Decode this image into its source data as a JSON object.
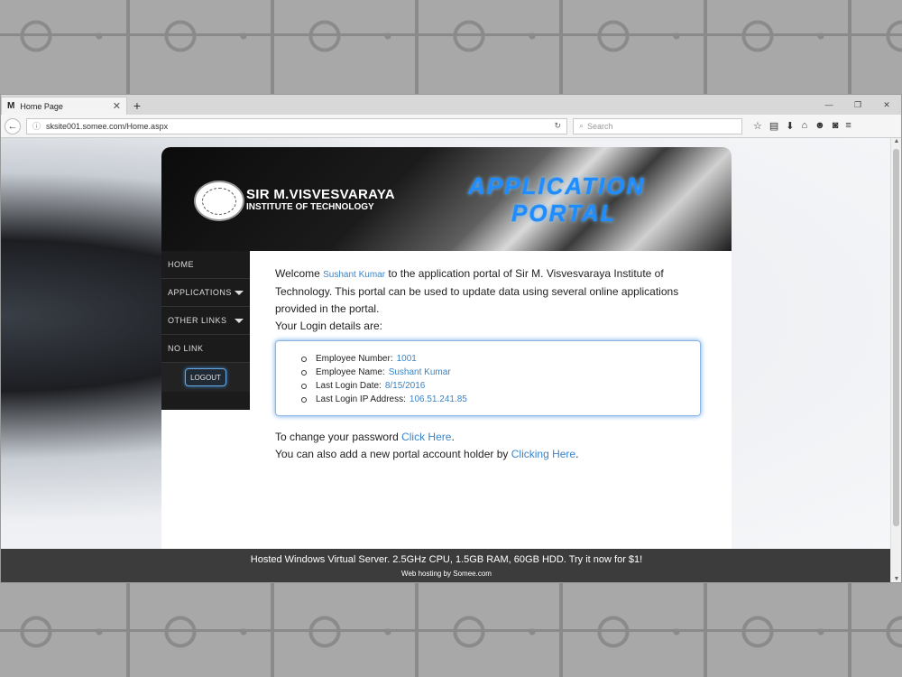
{
  "browser": {
    "tab_title": "Home Page",
    "tab_favicon": "M",
    "url": "sksite001.somee.com/Home.aspx",
    "search_placeholder": "Search"
  },
  "site": {
    "institution_line1": "SIR M.VISVESVARAYA",
    "institution_line2": "INSTITUTE OF TECHNOLOGY",
    "portal_title_line1": "APPLICATION",
    "portal_title_line2": "PORTAL",
    "accent_color": "#1f8cff"
  },
  "sidebar": {
    "items": [
      {
        "label": "HOME"
      },
      {
        "label": "APPLICATIONS"
      },
      {
        "label": "OTHER LINKS"
      },
      {
        "label": "NO LINK"
      }
    ],
    "logout_label": "LOGOUT"
  },
  "content": {
    "welcome_prefix": "Welcome",
    "user_name": "Sushant Kumar",
    "welcome_suffix": "to the application portal of Sir M. Visvesvaraya Institute of Technology.",
    "portal_desc": "This portal can be used to update data using several online applications provided in the portal.",
    "login_details_label": "Your Login details are:",
    "details": [
      {
        "label": "Employee Number:",
        "value": "1001"
      },
      {
        "label": "Employee Name:",
        "value": "Sushant Kumar"
      },
      {
        "label": "Last Login Date:",
        "value": "8/15/2016"
      },
      {
        "label": "Last Login IP Address:",
        "value": "106.51.241.85"
      }
    ],
    "change_pw_text": "To change your password",
    "change_pw_link": "Click Here",
    "add_holder_text": "You can also add a new portal account holder by",
    "add_holder_link": "Clicking Here",
    "period": "."
  },
  "footer": {
    "line1": "Hosted Windows Virtual Server. 2.5GHz CPU, 1.5GB RAM, 60GB HDD. Try it now for $1!",
    "line2": "Web hosting by Somee.com"
  }
}
